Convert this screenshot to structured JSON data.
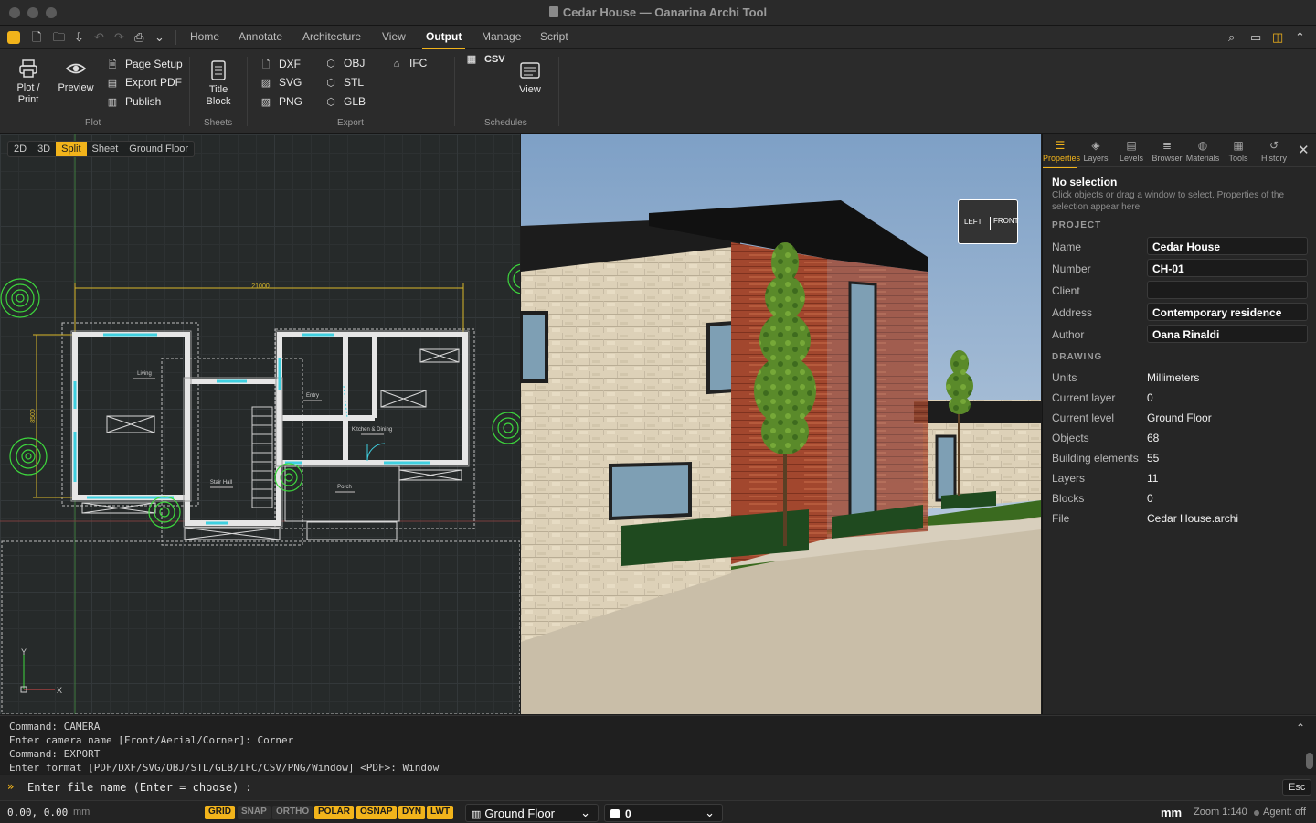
{
  "window": {
    "title": "Cedar House — Oanarina Archi Tool"
  },
  "menu": {
    "tabs": [
      "Home",
      "Annotate",
      "Architecture",
      "View",
      "Output",
      "Manage",
      "Script"
    ],
    "active_tab": "Output"
  },
  "ribbon": {
    "plot_print": "Plot / Print",
    "preview": "Preview",
    "page_setup": "Page Setup",
    "export_pdf": "Export PDF",
    "publish": "Publish",
    "title_block": "Title Block",
    "dxf": "DXF",
    "svg": "SVG",
    "png": "PNG",
    "obj": "OBJ",
    "stl": "STL",
    "glb": "GLB",
    "ifc": "IFC",
    "csv": "CSV",
    "view": "View",
    "groups": {
      "plot": "Plot",
      "sheets": "Sheets",
      "export": "Export",
      "schedules": "Schedules"
    }
  },
  "viewport2d": {
    "tabs": [
      "2D",
      "3D",
      "Split",
      "Sheet",
      "Ground Floor"
    ],
    "active_tab": "Split",
    "dim_width": "21000",
    "dim_height": "8500",
    "rooms": {
      "living": "Living",
      "entry": "Entry",
      "kitchen": "Kitchen & Dining",
      "stair": "Stair Hall",
      "porch": "Porch"
    },
    "axis_x": "X",
    "axis_y": "Y"
  },
  "viewport3d": {
    "cube_left": "LEFT",
    "cube_front": "FRONT"
  },
  "panel": {
    "tabs": [
      "Properties",
      "Layers",
      "Levels",
      "Browser",
      "Materials",
      "Tools",
      "History"
    ],
    "active_tab": "Properties",
    "no_selection": "No selection",
    "hint": "Click objects or drag a window to select. Properties of the selection appear here.",
    "project_header": "PROJECT",
    "project": [
      {
        "label": "Name",
        "value": "Cedar House"
      },
      {
        "label": "Number",
        "value": "CH-01"
      },
      {
        "label": "Client",
        "value": ""
      },
      {
        "label": "Address",
        "value": "Contemporary residence"
      },
      {
        "label": "Author",
        "value": "Oana Rinaldi"
      }
    ],
    "drawing_header": "DRAWING",
    "drawing": [
      {
        "label": "Units",
        "value": "Millimeters"
      },
      {
        "label": "Current layer",
        "value": "0"
      },
      {
        "label": "Current level",
        "value": "Ground Floor"
      },
      {
        "label": "Objects",
        "value": "68"
      },
      {
        "label": "Building elements",
        "value": "55"
      },
      {
        "label": "Layers",
        "value": "11"
      },
      {
        "label": "Blocks",
        "value": "0"
      },
      {
        "label": "File",
        "value": "Cedar House.archi"
      }
    ]
  },
  "command": {
    "history": [
      "Command: CAMERA",
      "Enter camera name [Front/Aerial/Corner]: Corner",
      "Command: EXPORT",
      "Enter format [PDF/DXF/SVG/OBJ/STL/GLB/IFC/CSV/PNG/Window] <PDF>: Window"
    ],
    "prompt": "Enter file name (Enter = choose) :",
    "esc": "Esc"
  },
  "status": {
    "coords": "0.00, 0.00",
    "coords_unit": "mm",
    "toggles": [
      {
        "label": "GRID",
        "on": true
      },
      {
        "label": "SNAP",
        "on": false
      },
      {
        "label": "ORTHO",
        "on": false
      },
      {
        "label": "POLAR",
        "on": true
      },
      {
        "label": "OSNAP",
        "on": true
      },
      {
        "label": "DYN",
        "on": true
      },
      {
        "label": "LWT",
        "on": true
      }
    ],
    "level": "Ground Floor",
    "layer": "0",
    "units": "mm",
    "zoom": "Zoom 1:140",
    "agent": "Agent: off"
  },
  "colors": {
    "accent": "#f2b41b",
    "wall_glass": "#3fd0e0",
    "dimension": "#d9b82a"
  }
}
